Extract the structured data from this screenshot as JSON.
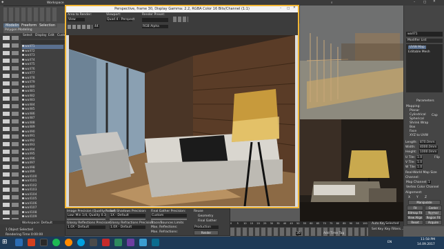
{
  "titlebar": {
    "title": "Workspace",
    "win_title": "Perspective, frame 30, Display Gamma: 2.2, RGBA Color 16 Bits/Channel (1:1)"
  },
  "tabs": {
    "modeling": "Modeling",
    "freeform": "Freeform",
    "selection": "Selection",
    "polygon_modeling": "Polygon Modeling"
  },
  "explorer": {
    "menu": [
      "Select",
      "Display",
      "Edit",
      "Customize"
    ],
    "items": [
      "wall71",
      "wall72",
      "wall73",
      "wall74",
      "wall75",
      "wall76",
      "wall77",
      "wall78",
      "wall79",
      "wall80",
      "wall81",
      "wall82",
      "wall83",
      "wall84",
      "wall85",
      "wall86",
      "wall87",
      "wall88",
      "wall89",
      "wall90",
      "wall91",
      "wall92",
      "wall93",
      "wall94",
      "wall95",
      "wall96",
      "wall97",
      "wall98",
      "wall99",
      "wall100",
      "wall101",
      "wall102",
      "wall103",
      "wall104",
      "wall105",
      "wall106",
      "wall107",
      "wall108",
      "wall109"
    ],
    "workspace": "Workspace: Default",
    "selection_status": "1 Object Selected",
    "render_time": "Rendering Time 0:00:00"
  },
  "render_window": {
    "area_label": "Area to Render:",
    "area_value": "View",
    "viewport_label": "Viewport:",
    "viewport_value": "Quad 4 - Perspect",
    "preset_label": "Render Preset:",
    "preset_value": "",
    "channel": "RGB Alpha",
    "frame_num": "44"
  },
  "render_settings": {
    "img_precision_label": "Image Precision (Quality/Noise):",
    "img_precision_value": "Low: Min 1/4, Quality 0.3",
    "soft_shadows_label": "Soft Shadows Precision:",
    "soft_shadows_value": "1X - Default",
    "final_gather_label": "Final Gather Precision:",
    "final_gather_value": "Custom",
    "glossy_refl_label": "Glossy Reflections Precision:",
    "glossy_refl_value": "1.0X - Default",
    "glossy_refr_label": "Glossy Refractions Precision:",
    "glossy_refr_value": "1.0X - Default",
    "trace_label": "Trace/Bounces Limits",
    "max_refl_label": "Max. Reflections:",
    "max_refr_label": "Max. Refractions:",
    "reuse_label": "Reuse",
    "geometry_label": "Geometry",
    "final_gather_check": "Final Gather",
    "production": "Production",
    "render_btn": "Render"
  },
  "cmd_panel": {
    "object_name": "wall71",
    "modifier_list": "Modifier List",
    "stack": [
      "UVW Map",
      "Editable Mesh"
    ],
    "params_title": "Parameters",
    "mapping_label": "Mapping:",
    "mapping_opts": [
      "Planar",
      "Cylindrical",
      "Spherical",
      "Shrink Wrap",
      "Box",
      "Face",
      "XYZ to UVW"
    ],
    "cap_label": "Cap",
    "length_label": "Length:",
    "length_value": "870.0mm",
    "width_label": "Width:",
    "width_value": "4000.0mm",
    "height_label": "Height:",
    "height_value": "1000.0mm",
    "utile_label": "U Tile:",
    "utile_value": "1.0",
    "vtile_label": "V Tile:",
    "vtile_value": "1.0",
    "wtile_label": "W Tile:",
    "wtile_value": "1.0",
    "flip_label": "Flip",
    "realworld_label": "Real-World Map Size",
    "channel_label": "Channel:",
    "map_channel_label": "Map Channel:",
    "map_channel_value": "1",
    "vertex_color_label": "Vertex Color Channel",
    "alignment_label": "Alignment:",
    "axes": [
      "X",
      "Y",
      "Z"
    ],
    "manipulate": "Manipulate",
    "fit": "Fit",
    "center": "Center",
    "bitmap_fit": "Bitmap Fit",
    "normal_align": "Normal Align",
    "view_align": "View Align",
    "region_fit": "Region Fit",
    "reset": "Reset",
    "acquire": "Acquire"
  },
  "timeline": {
    "ticks": [
      "0",
      "5",
      "10",
      "15",
      "20",
      "25",
      "30",
      "35",
      "40",
      "45",
      "50",
      "55",
      "60",
      "65",
      "70",
      "75",
      "80",
      "85",
      "90",
      "95",
      "100"
    ],
    "auto_key": "Auto Key",
    "selected": "Selected",
    "set_key": "Set Key",
    "key_filters": "Key Filters...",
    "add_time_tag": "Add Time Tag",
    "frame_value": "30"
  },
  "taskbar": {
    "lang": "EN",
    "time": "11:58 PM",
    "date": "14.09.2017"
  }
}
